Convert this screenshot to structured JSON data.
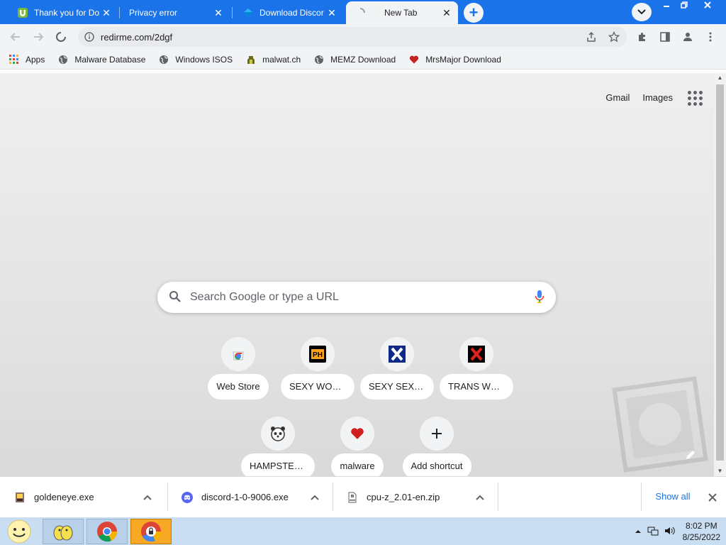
{
  "tabs": [
    {
      "title": "Thank you for Do",
      "favicon": "utorrent-icon"
    },
    {
      "title": "Privacy error",
      "favicon": "none"
    },
    {
      "title": "Download Discor",
      "favicon": "vlc-diamond-icon"
    },
    {
      "title": "New Tab",
      "favicon": "loading-spinner-icon",
      "active": true
    }
  ],
  "window_controls": [
    "minimize",
    "restore",
    "close"
  ],
  "toolbar": {
    "url": "redirme.com/2dgf"
  },
  "bookmarks": [
    {
      "label": "Apps",
      "icon": "apps-grid-icon"
    },
    {
      "label": "Malware Database",
      "icon": "globe-icon"
    },
    {
      "label": "Windows ISOS",
      "icon": "globe-icon"
    },
    {
      "label": "malwat.ch",
      "icon": "malwatch-icon"
    },
    {
      "label": "MEMZ Download",
      "icon": "globe-icon"
    },
    {
      "label": "MrsMajor Download",
      "icon": "heart-icon"
    }
  ],
  "ntp": {
    "gmail": "Gmail",
    "images": "Images",
    "search_placeholder": "Search Google or type a URL",
    "shortcuts": [
      {
        "label": "Web Store",
        "icon": "chrome-webstore-icon"
      },
      {
        "label": "SEXY WOMEN",
        "icon": "ph-logo-icon"
      },
      {
        "label": "SEXY SEX PO...",
        "icon": "x-blue-icon"
      },
      {
        "label": "TRANS WOM...",
        "icon": "x-red-icon"
      },
      {
        "label": "HAMPSTERS",
        "icon": "hamster-icon"
      },
      {
        "label": "malware",
        "icon": "heart-icon"
      },
      {
        "label": "Add shortcut",
        "icon": "plus-icon"
      }
    ]
  },
  "downloads": [
    {
      "name": "goldeneye.exe",
      "icon": "goldeneye-icon"
    },
    {
      "name": "discord-1-0-9006.exe",
      "icon": "discord-icon"
    },
    {
      "name": "cpu-z_2.01-en.zip",
      "icon": "zip-icon"
    }
  ],
  "downloads_show_all": "Show all",
  "taskbar": {
    "time": "8:02 PM",
    "date": "8/25/2022"
  },
  "colors": {
    "tabstrip": "#1a73e8",
    "toolbar": "#f1f3f4",
    "accent": "#1a73e8"
  }
}
